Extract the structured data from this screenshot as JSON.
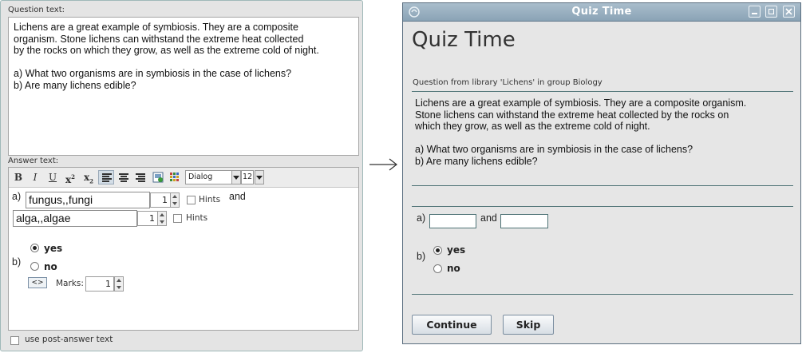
{
  "editor": {
    "question_label": "Question text:",
    "question_text": "Lichens are a great example of symbiosis. They are a composite\norganism. Stone lichens can withstand the extreme heat collected\nby the rocks on which they grow, as well as the extreme cold of night.\n\na) What two organisms are in symbiosis in the case of lichens?\nb) Are many lichens edible?",
    "answer_label": "Answer text:",
    "toolbar": {
      "bold": "B",
      "italic": "I",
      "underline": "U",
      "superscript": "x",
      "sup_mark": "2",
      "subscript": "x",
      "sub_mark": "2",
      "font_name": "Dialog",
      "font_size": "12"
    },
    "answer": {
      "a_label": "a)",
      "field1_value": "fungus,,fungi",
      "field1_marks": "1",
      "hints_label": "Hints",
      "and_label": "and",
      "field2_value": "alga,,algae",
      "field2_marks": "1",
      "b_label": "b)",
      "option_yes": "yes",
      "option_no": "no",
      "toggle_label": "<>",
      "marks_label": "Marks:",
      "marks_value": "1"
    },
    "post_answer_label": "use post-answer text"
  },
  "quiz": {
    "window_title": "Quiz Time",
    "heading": "Quiz Time",
    "library_line": "Question from library 'Lichens' in group Biology",
    "question_text": "Lichens are a great example of symbiosis. They are a composite organism.\nStone lichens can withstand the extreme heat collected by the rocks on\nwhich they grow, as well as the extreme cold of night.\n\na) What two organisms are in symbiosis in the case of lichens?\nb) Are many lichens edible?",
    "a_label": "a)",
    "and_label": "and",
    "b_label": "b)",
    "option_yes": "yes",
    "option_no": "no",
    "continue_label": "Continue",
    "skip_label": "Skip"
  },
  "colors": {
    "separator": "#4f7376",
    "titlebar": "#8aa3b6"
  }
}
